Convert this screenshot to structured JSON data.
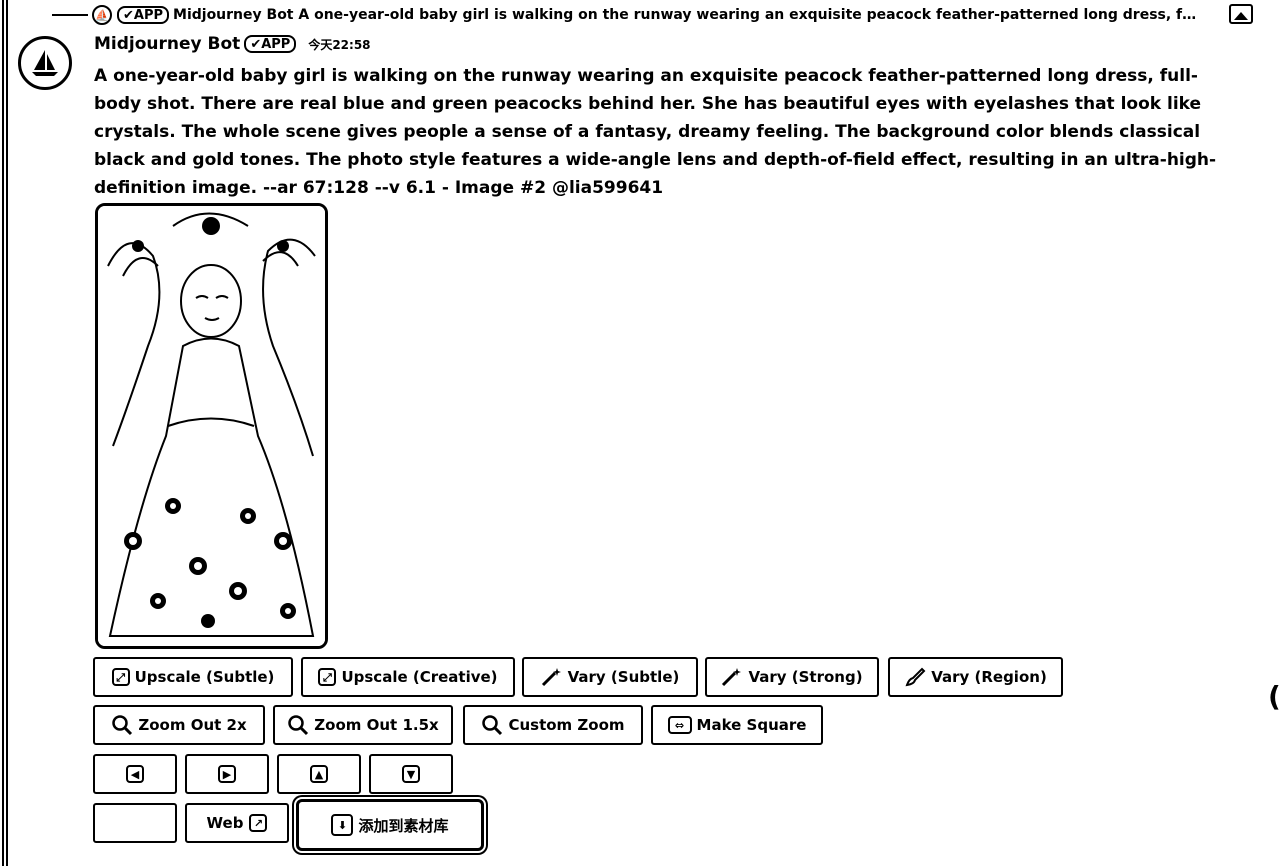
{
  "reply": {
    "badge": "✔APP",
    "text": "Midjourney Bot A one-year-old baby girl is walking on the runway wearing an exquisite peacock feather-patterned long dress, full..."
  },
  "message": {
    "author": "Midjourney Bot",
    "badge": "✔APP",
    "time": "今天22:58",
    "prompt": "A one-year-old baby girl is walking on the runway wearing an exquisite peacock feather-patterned long dress, full-body shot. There are real blue and green peacocks behind her. She has beautiful eyes with eyelashes that look like crystals. The whole scene gives people a sense of a fantasy, dreamy feeling. The background color blends classical black and gold tones. The photo style features a wide-angle lens and depth-of-field effect, resulting in an ultra-high-definition image. --ar 67:128 --v 6.1 - Image #2 @lia599641"
  },
  "buttons": {
    "upscale_subtle": "Upscale (Subtle)",
    "upscale_creative": "Upscale (Creative)",
    "vary_subtle": "Vary (Subtle)",
    "vary_strong": "Vary (Strong)",
    "vary_region": "Vary (Region)",
    "zoom_out_2x": "Zoom Out 2x",
    "zoom_out_15x": "Zoom Out 1.5x",
    "custom_zoom": "Custom Zoom",
    "make_square": "Make Square",
    "web": "Web",
    "add_to_library": "添加到素材库"
  },
  "icons": {
    "upscale": "upscale-icon",
    "vary": "magic-wand-icon",
    "region": "brush-icon",
    "zoom": "magnifier-icon",
    "square": "make-square-icon",
    "arrows": [
      "arrow-left-icon",
      "arrow-right-icon",
      "arrow-up-icon",
      "arrow-down-icon"
    ],
    "external": "external-link-icon",
    "download": "download-icon"
  },
  "edge_glyph": "("
}
